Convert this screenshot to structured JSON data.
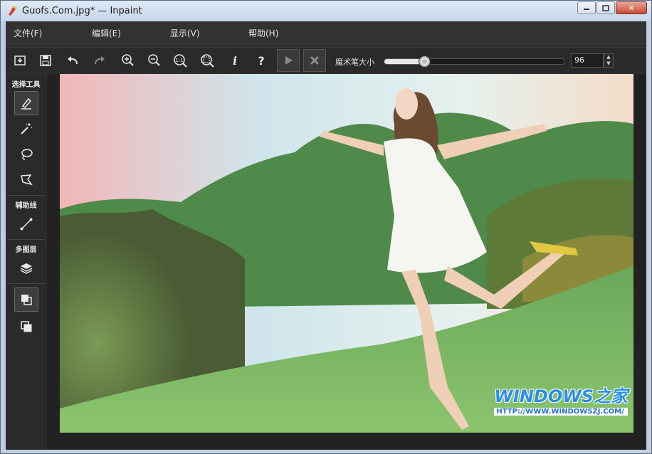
{
  "window": {
    "title": "Guofs.Com.jpg* — Inpaint",
    "minimize": "▭",
    "maximize": "▣",
    "close": "✕"
  },
  "menu": [
    {
      "label": "文件(F)"
    },
    {
      "label": "编辑(E)"
    },
    {
      "label": "显示(V)"
    },
    {
      "label": "帮助(H)"
    }
  ],
  "toolbar": {
    "icons": [
      "open-icon",
      "save-icon",
      "undo-icon",
      "redo-icon",
      "zoom-in-icon",
      "zoom-out-icon",
      "actual-size-icon",
      "fit-icon",
      "info-icon",
      "help-icon",
      "run-icon",
      "cancel-icon"
    ],
    "info_glyph": "i",
    "help_glyph": "?",
    "actual_size_glyph": "1:1",
    "brush_label": "魔术笔大小",
    "brush_value": "96",
    "brush_fraction": 0.22
  },
  "sidebar": {
    "section_select": "选择工具",
    "section_guide": "辅助线",
    "section_layers": "多图层",
    "tools": [
      "marker-icon",
      "magic-wand-icon",
      "lasso-icon",
      "polygon-lasso-icon",
      "guide-line-icon",
      "layers-icon",
      "layer-copy-icon",
      "layer-back-icon"
    ]
  },
  "watermark": {
    "title": "WINDOWS之家",
    "url": "HTTP://WWW.WINDOWSZJ.COM/"
  },
  "colors": {
    "titlebar": "#c7d7ea",
    "app_bg": "#2a2a2a",
    "accent": "#2a8fe6"
  }
}
